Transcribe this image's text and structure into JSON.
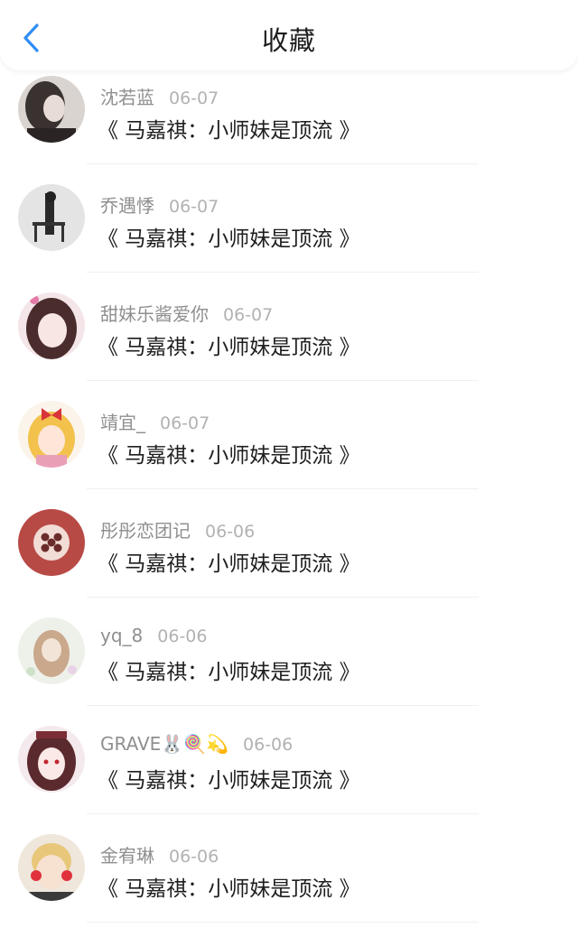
{
  "header": {
    "title": "收藏",
    "back_icon": "chevron-left-icon",
    "accent": "#2f8df5"
  },
  "favorites": [
    {
      "name": "沈若蓝",
      "date": "06-07",
      "book": "《 马嘉祺：小师妹是顶流 》"
    },
    {
      "name": "乔遇悸",
      "date": "06-07",
      "book": "《 马嘉祺：小师妹是顶流 》"
    },
    {
      "name": "甜妹乐酱爱你",
      "date": "06-07",
      "book": "《 马嘉祺：小师妹是顶流 》"
    },
    {
      "name": "靖宜_",
      "date": "06-07",
      "book": "《 马嘉祺：小师妹是顶流 》"
    },
    {
      "name": "彤彤恋团记",
      "date": "06-06",
      "book": "《 马嘉祺：小师妹是顶流 》"
    },
    {
      "name": "yq_8",
      "date": "06-06",
      "book": "《 马嘉祺：小师妹是顶流 》"
    },
    {
      "name": "GRAVE🐰🍭💫",
      "date": "06-06",
      "book": "《 马嘉祺：小师妹是顶流 》"
    },
    {
      "name": "金宥琳",
      "date": "06-06",
      "book": "《 马嘉祺：小师妹是顶流 》"
    }
  ]
}
